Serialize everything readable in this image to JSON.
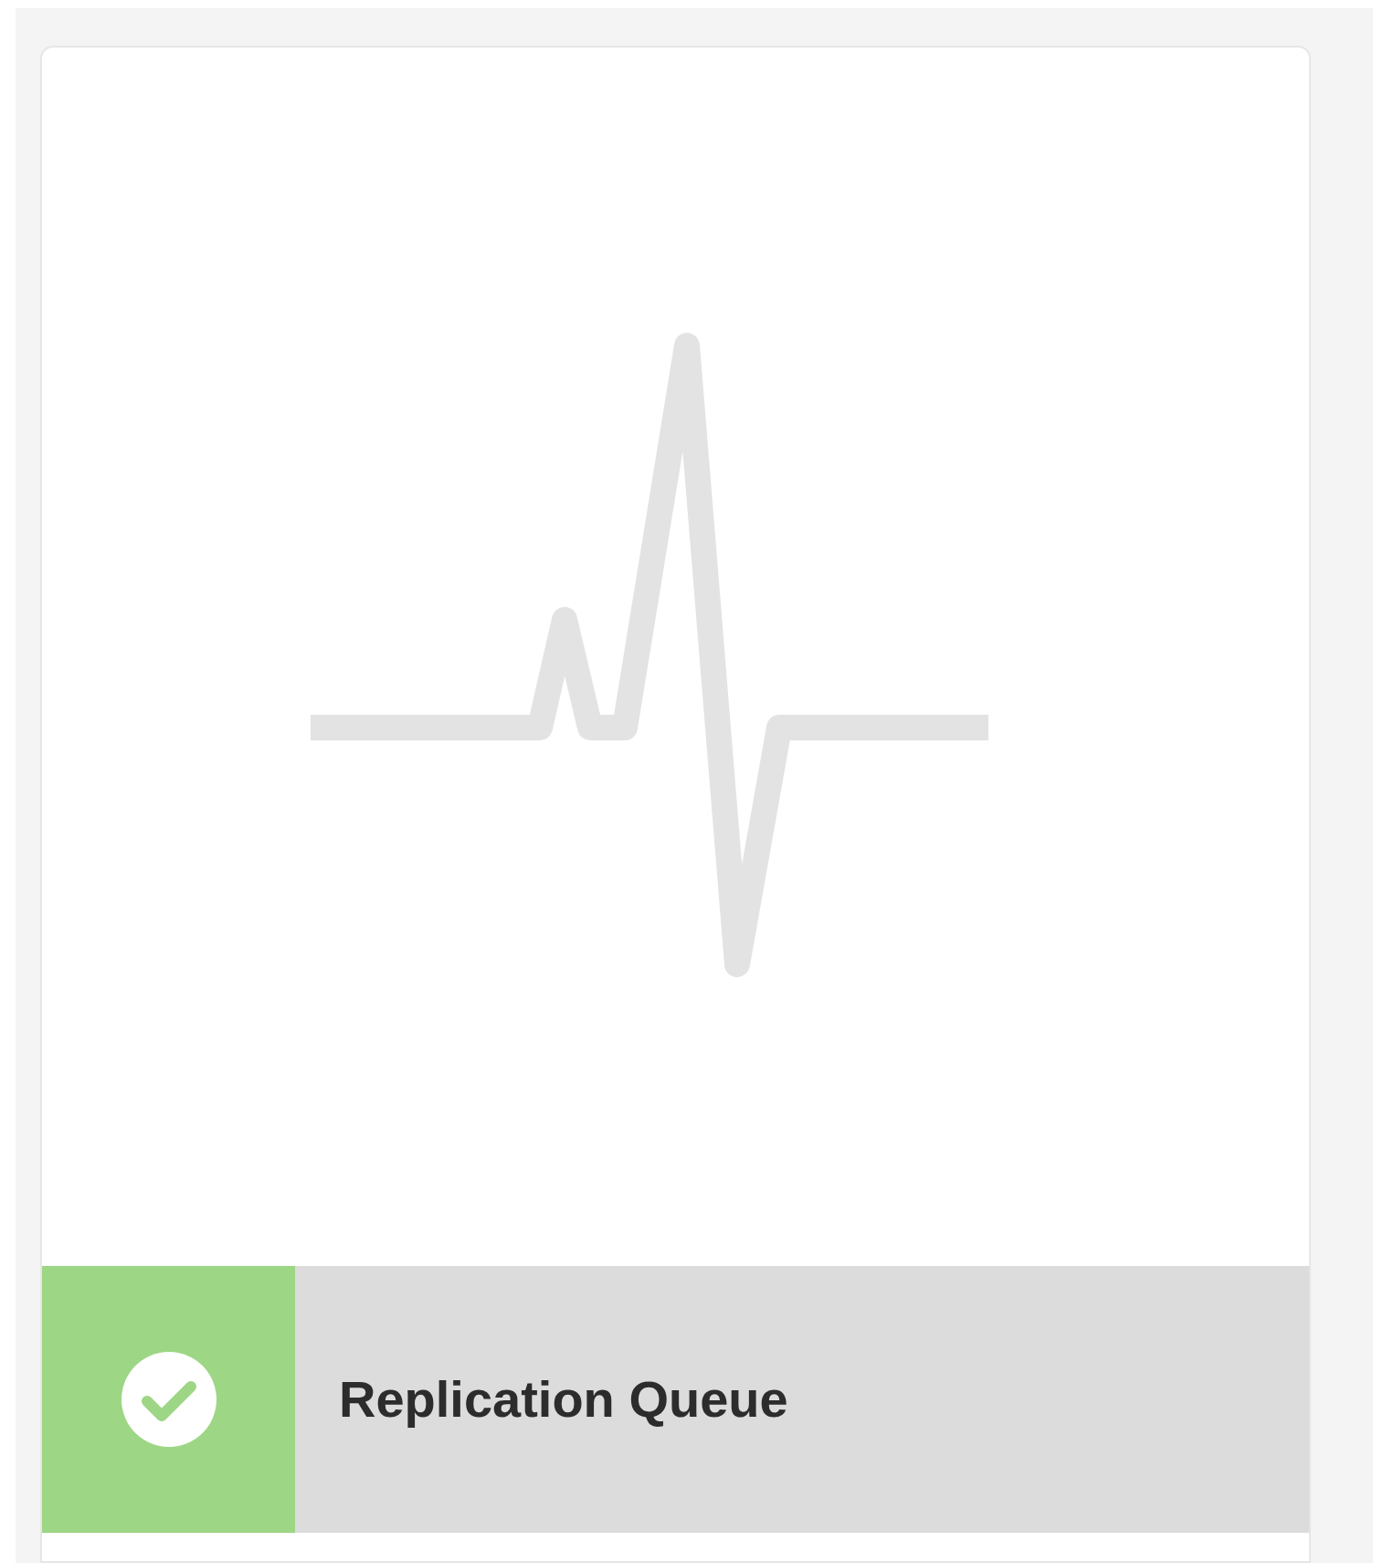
{
  "card": {
    "title": "Replication Queue",
    "healthy": true
  }
}
